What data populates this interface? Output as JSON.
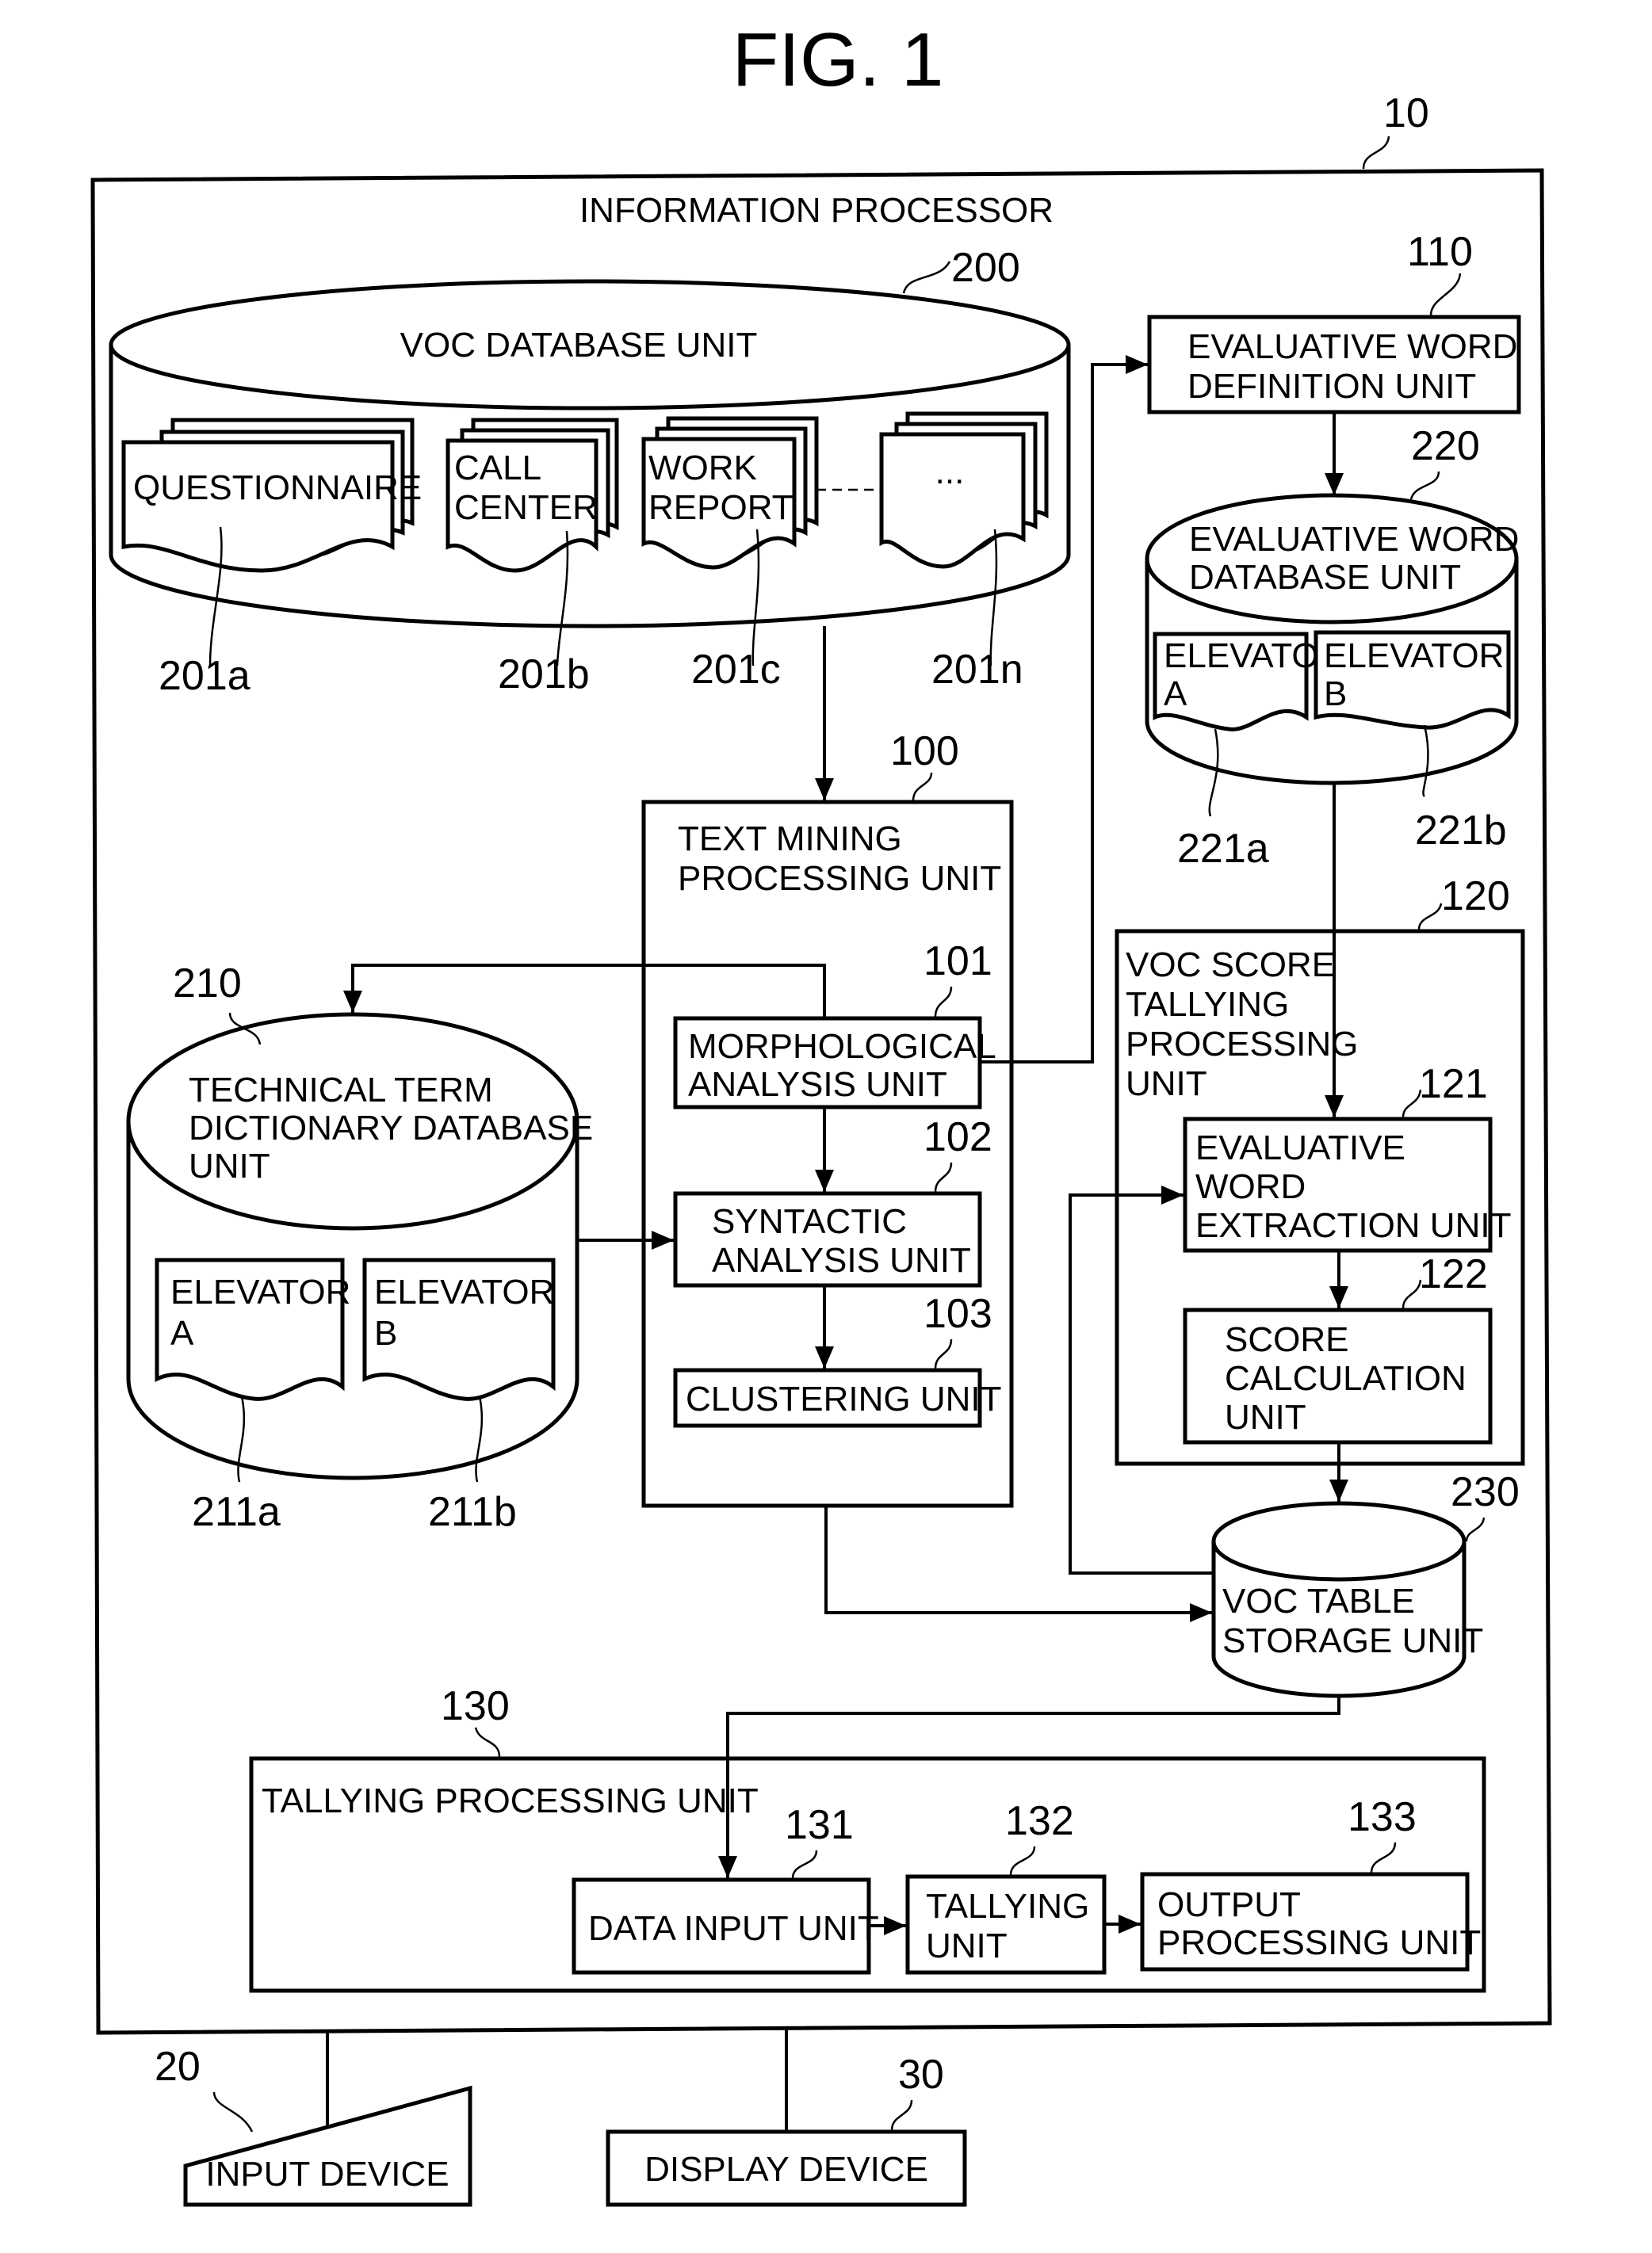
{
  "figure": {
    "title": "FIG. 1"
  },
  "information_processor": {
    "ref": "10",
    "label": "INFORMATION PROCESSOR"
  },
  "voc_database": {
    "ref": "200",
    "label": "VOC DATABASE UNIT",
    "documents": [
      {
        "ref": "201a",
        "lines": [
          "QUESTIONNAIRE"
        ]
      },
      {
        "ref": "201b",
        "lines": [
          "CALL",
          "CENTER"
        ]
      },
      {
        "ref": "201c",
        "lines": [
          "WORK",
          "REPORT"
        ]
      },
      {
        "ref": "201n",
        "lines": [
          "..."
        ]
      }
    ]
  },
  "evaluative_word_definition": {
    "ref": "110",
    "lines": [
      "EVALUATIVE WORD",
      "DEFINITION UNIT"
    ]
  },
  "evaluative_word_database": {
    "ref": "220",
    "lines": [
      "EVALUATIVE WORD",
      "DATABASE UNIT"
    ],
    "documents": [
      {
        "ref": "221a",
        "lines": [
          "ELEVATOR",
          "A"
        ]
      },
      {
        "ref": "221b",
        "lines": [
          "ELEVATOR",
          "B"
        ]
      }
    ]
  },
  "text_mining": {
    "ref": "100",
    "lines": [
      "TEXT MINING",
      "PROCESSING UNIT"
    ],
    "morphological": {
      "ref": "101",
      "lines": [
        "MORPHOLOGICAL",
        "ANALYSIS UNIT"
      ]
    },
    "syntactic": {
      "ref": "102",
      "lines": [
        "SYNTACTIC",
        "ANALYSIS UNIT"
      ]
    },
    "clustering": {
      "ref": "103",
      "lines": [
        "CLUSTERING UNIT"
      ]
    }
  },
  "technical_term_database": {
    "ref": "210",
    "lines": [
      "TECHNICAL TERM",
      "DICTIONARY DATABASE",
      "UNIT"
    ],
    "documents": [
      {
        "ref": "211a",
        "lines": [
          "ELEVATOR",
          "A"
        ]
      },
      {
        "ref": "211b",
        "lines": [
          "ELEVATOR",
          "B"
        ]
      }
    ]
  },
  "voc_score_tallying": {
    "ref": "120",
    "lines": [
      "VOC SCORE",
      "TALLYING",
      "PROCESSING",
      "UNIT"
    ],
    "extraction": {
      "ref": "121",
      "lines": [
        "EVALUATIVE",
        "WORD",
        "EXTRACTION UNIT"
      ]
    },
    "score_calc": {
      "ref": "122",
      "lines": [
        "SCORE",
        "CALCULATION",
        "UNIT"
      ]
    }
  },
  "voc_table_storage": {
    "ref": "230",
    "lines": [
      "VOC TABLE",
      "STORAGE UNIT"
    ]
  },
  "tallying_processing": {
    "ref": "130",
    "label": "TALLYING PROCESSING UNIT",
    "data_input": {
      "ref": "131",
      "lines": [
        "DATA INPUT UNIT"
      ]
    },
    "tallying": {
      "ref": "132",
      "lines": [
        "TALLYING",
        "UNIT"
      ]
    },
    "output": {
      "ref": "133",
      "lines": [
        "OUTPUT",
        "PROCESSING UNIT"
      ]
    }
  },
  "input_device": {
    "ref": "20",
    "label": "INPUT DEVICE"
  },
  "display_device": {
    "ref": "30",
    "label": "DISPLAY DEVICE"
  }
}
